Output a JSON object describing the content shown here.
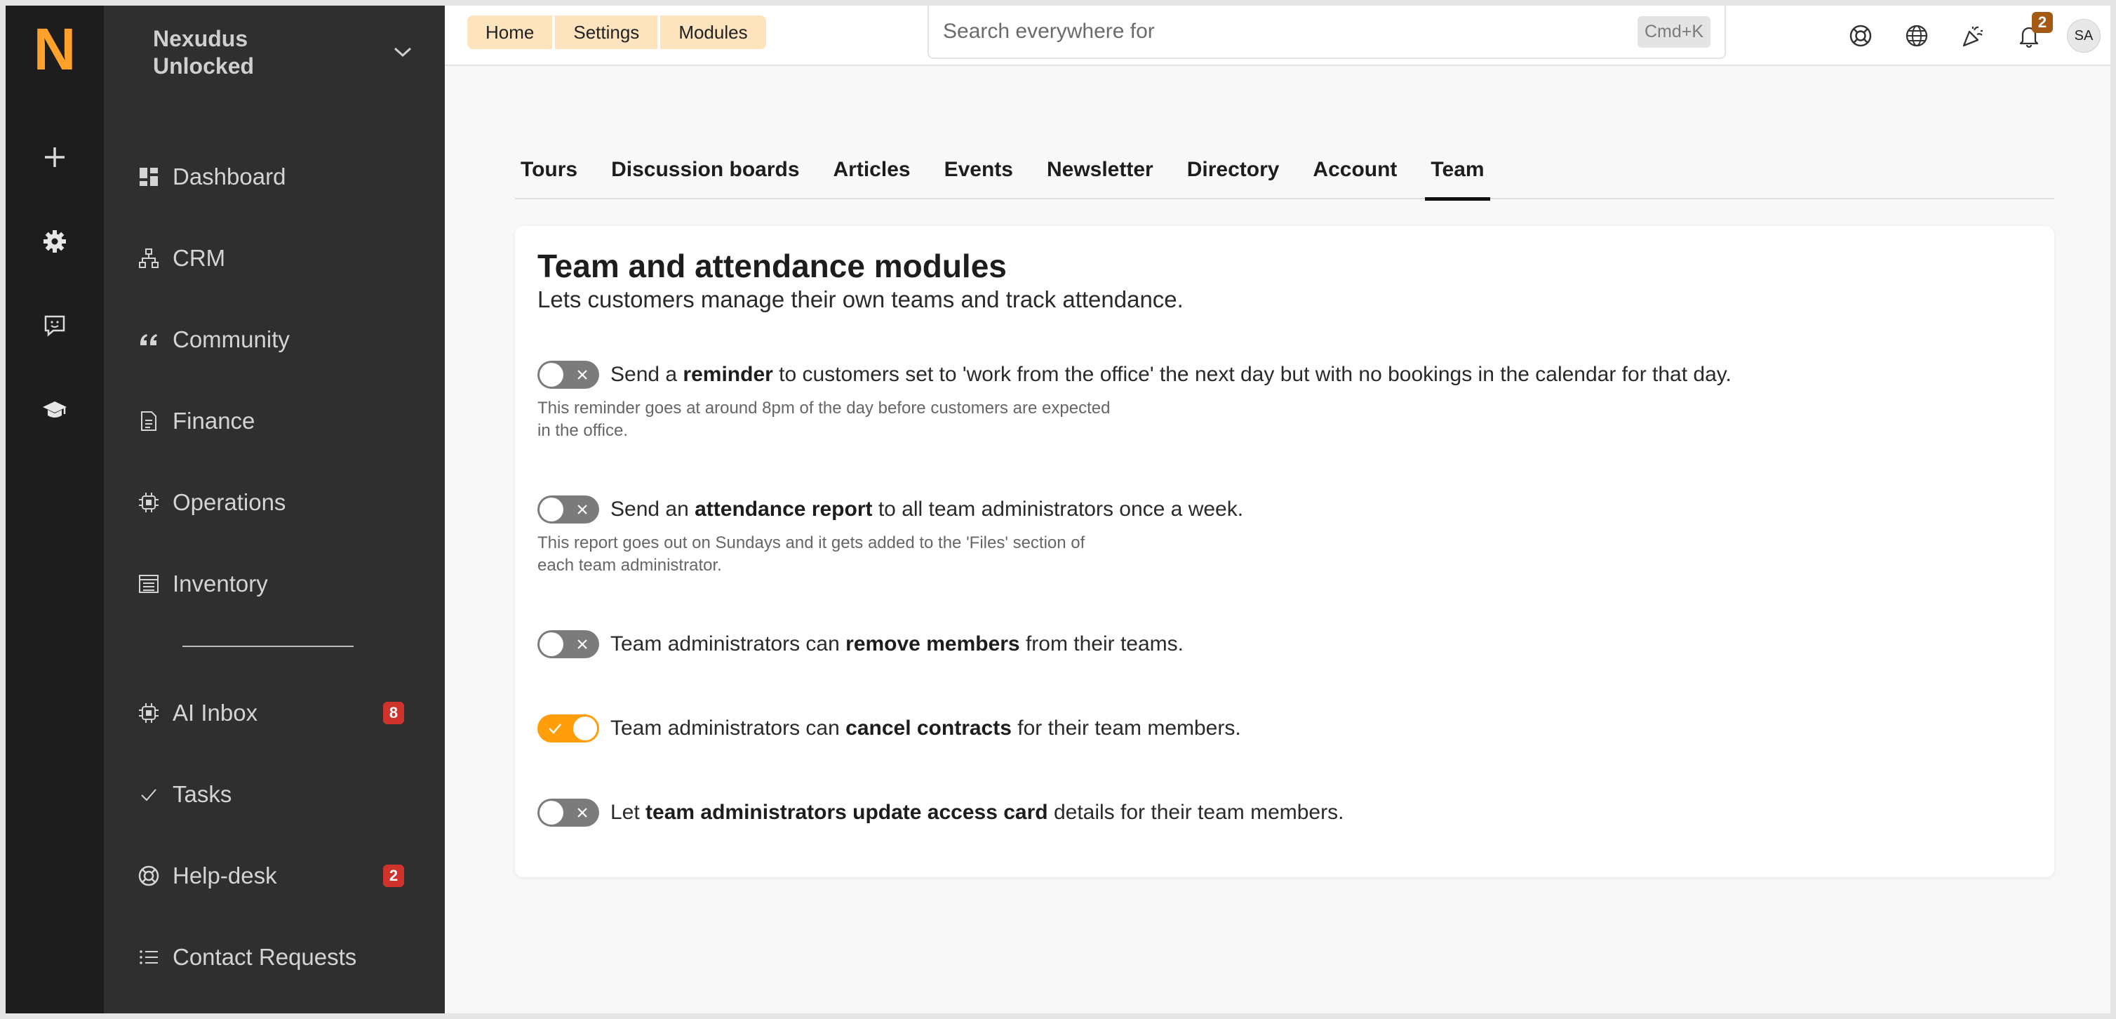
{
  "rail": {
    "logo": "N",
    "items": [
      {
        "icon": "plus-icon"
      },
      {
        "icon": "gear-icon"
      },
      {
        "icon": "chat-feedback-icon"
      },
      {
        "icon": "graduation-cap-icon"
      }
    ]
  },
  "sidebar": {
    "org_name": "Nexudus Unlocked",
    "items": [
      {
        "label": "Dashboard",
        "icon": "dashboard-icon"
      },
      {
        "label": "CRM",
        "icon": "network-icon"
      },
      {
        "label": "Community",
        "icon": "quote-icon"
      },
      {
        "label": "Finance",
        "icon": "document-icon"
      },
      {
        "label": "Operations",
        "icon": "chip-icon"
      },
      {
        "label": "Inventory",
        "icon": "list-box-icon"
      }
    ],
    "items2": [
      {
        "label": "AI Inbox",
        "icon": "chip-icon",
        "badge": "8"
      },
      {
        "label": "Tasks",
        "icon": "check-icon",
        "badge": ""
      },
      {
        "label": "Help-desk",
        "icon": "lifebuoy-icon",
        "badge": "2"
      },
      {
        "label": "Contact Requests",
        "icon": "list-icon",
        "badge": ""
      }
    ]
  },
  "topbar": {
    "breadcrumbs": [
      "Home",
      "Settings",
      "Modules"
    ],
    "search_placeholder": "Search everywhere for",
    "search_shortcut": "Cmd+K",
    "notifications_count": "2",
    "avatar_initials": "SA"
  },
  "tabs": [
    {
      "label": "Tours",
      "active": false
    },
    {
      "label": "Discussion boards",
      "active": false
    },
    {
      "label": "Articles",
      "active": false
    },
    {
      "label": "Events",
      "active": false
    },
    {
      "label": "Newsletter",
      "active": false
    },
    {
      "label": "Directory",
      "active": false
    },
    {
      "label": "Account",
      "active": false
    },
    {
      "label": "Team",
      "active": true
    }
  ],
  "card": {
    "title": "Team and attendance modules",
    "subtitle": "Lets customers manage their own teams and track attendance.",
    "settings": [
      {
        "on": false,
        "pre": "Send a ",
        "bold": "reminder",
        "post": " to customers set to 'work from the office' the next day but with no bookings in the calendar for that day.",
        "help": "This reminder goes at around 8pm of the day before customers are expected in the office."
      },
      {
        "on": false,
        "pre": "Send an ",
        "bold": "attendance report",
        "post": " to all team administrators once a week.",
        "help": "This report goes out on Sundays and it gets added to the 'Files' section of each team administrator."
      },
      {
        "on": false,
        "pre": "Team administrators can ",
        "bold": "remove members",
        "post": " from their teams.",
        "help": ""
      },
      {
        "on": true,
        "pre": "Team administrators can ",
        "bold": "cancel contracts",
        "post": " for their team members.",
        "help": ""
      },
      {
        "on": false,
        "pre": "Let ",
        "bold": "team administrators update access card",
        "post": " details for their team members.",
        "help": ""
      }
    ]
  },
  "colors": {
    "accent": "#ff9d0a",
    "rail_bg": "#1d1d1d",
    "sidebar_bg": "#2f2f2f",
    "breadcrumb_bg": "#fde4bf",
    "badge_red": "#d0322c"
  }
}
